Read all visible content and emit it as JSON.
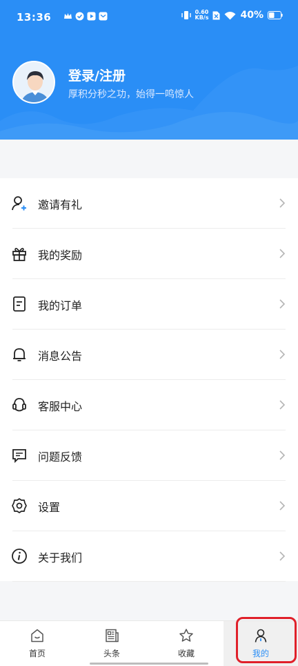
{
  "status": {
    "time": "13:36",
    "net_speed_value": "0.60",
    "net_speed_unit": "KB/s",
    "battery": "40%"
  },
  "profile": {
    "title": "登录/注册",
    "subtitle": "厚积分秒之功，始得一鸣惊人"
  },
  "menu": {
    "items": [
      {
        "label": "邀请有礼",
        "icon": "user-add-icon"
      },
      {
        "label": "我的奖励",
        "icon": "gift-icon"
      },
      {
        "label": "我的订单",
        "icon": "order-icon"
      },
      {
        "label": "消息公告",
        "icon": "bell-icon"
      },
      {
        "label": "客服中心",
        "icon": "headset-icon"
      },
      {
        "label": "问题反馈",
        "icon": "feedback-icon"
      },
      {
        "label": "设置",
        "icon": "gear-icon"
      },
      {
        "label": "关于我们",
        "icon": "info-icon"
      }
    ]
  },
  "tabbar": {
    "tabs": [
      {
        "label": "首页",
        "icon": "home-icon"
      },
      {
        "label": "头条",
        "icon": "news-icon"
      },
      {
        "label": "收藏",
        "icon": "star-icon"
      },
      {
        "label": "我的",
        "icon": "person-icon",
        "active": true
      }
    ]
  },
  "colors": {
    "brand": "#2a8ef6",
    "highlight": "#e0202a"
  }
}
